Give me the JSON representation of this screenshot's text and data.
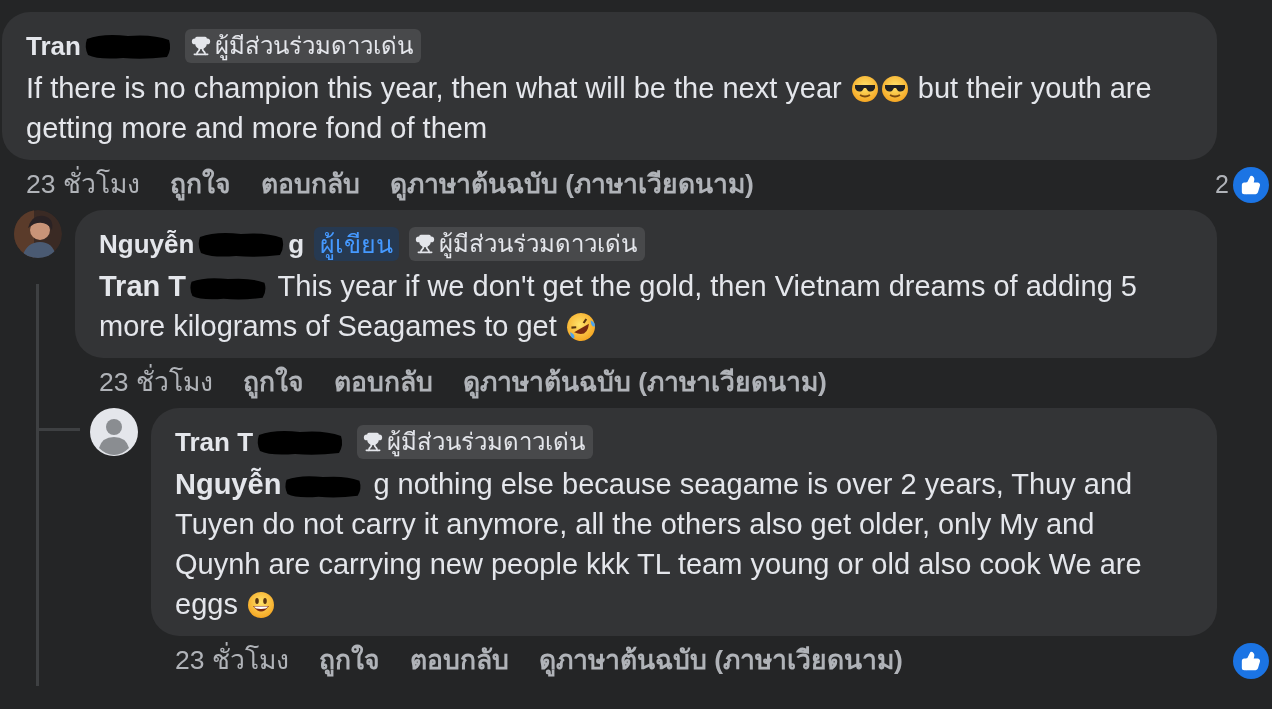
{
  "comments": [
    {
      "author": [
        {
          "kind": "text",
          "text": "Tran"
        },
        {
          "kind": "redacted"
        }
      ],
      "badges": [
        {
          "kind": "top_fan",
          "label": "ผู้มีส่วนร่วมดาวเด่น"
        }
      ],
      "body": [
        {
          "kind": "text",
          "text": "If there is no champion this year, then what will be the next year"
        },
        {
          "kind": "emoji_cool"
        },
        {
          "kind": "emoji_cool"
        },
        {
          "kind": "text",
          "text": "but their youth are getting more and more fond of them"
        }
      ],
      "actions": [
        "23 ชั่วโมง",
        "ถูกใจ",
        "ตอบกลับ",
        "ดูภาษาต้นฉบับ (ภาษาเวียดนาม)"
      ],
      "reactions": {
        "liked": true,
        "count": "2"
      },
      "replies": [
        {
          "avatar": {
            "kind": "picture"
          },
          "author": [
            {
              "kind": "text",
              "text": "Nguyễn"
            },
            {
              "kind": "redacted"
            },
            {
              "kind": "text",
              "text": "g"
            }
          ],
          "badges": [
            {
              "kind": "author",
              "label": "ผู้เขียน"
            },
            {
              "kind": "top_fan",
              "label": "ผู้มีส่วนร่วมดาวเด่น"
            }
          ],
          "body": [
            {
              "kind": "mention",
              "text": "Tran T"
            },
            {
              "kind": "redacted"
            },
            {
              "kind": "text",
              "text": "This year if we don't get the gold, then Vietnam dreams of adding 5 more kilograms of Seagames to get"
            },
            {
              "kind": "emoji_rofl"
            }
          ],
          "actions": [
            "23 ชั่วโมง",
            "ถูกใจ",
            "ตอบกลับ",
            "ดูภาษาต้นฉบับ (ภาษาเวียดนาม)"
          ],
          "replies": [
            {
              "avatar": {
                "kind": "default"
              },
              "author": [
                {
                  "kind": "text",
                  "text": "Tran T"
                },
                {
                  "kind": "redacted"
                }
              ],
              "badges": [
                {
                  "kind": "top_fan",
                  "label": "ผู้มีส่วนร่วมดาวเด่น"
                }
              ],
              "body": [
                {
                  "kind": "mention",
                  "text": "Nguyễn"
                },
                {
                  "kind": "redacted"
                },
                {
                  "kind": "text",
                  "text": "g nothing else because seagame is over 2 years, Thuy and Tuyen do not carry it anymore, all the others also get older, only My and Quynh are carrying new people kkk TL team young or old also cook We are eggs"
                },
                {
                  "kind": "emoji_grin"
                }
              ],
              "actions": [
                "23 ชั่วโมง",
                "ถูกใจ",
                "ตอบกลับ",
                "ดูภาษาต้นฉบับ (ภาษาเวียดนาม)"
              ],
              "reactions": {
                "liked": true
              }
            }
          ]
        }
      ]
    }
  ]
}
